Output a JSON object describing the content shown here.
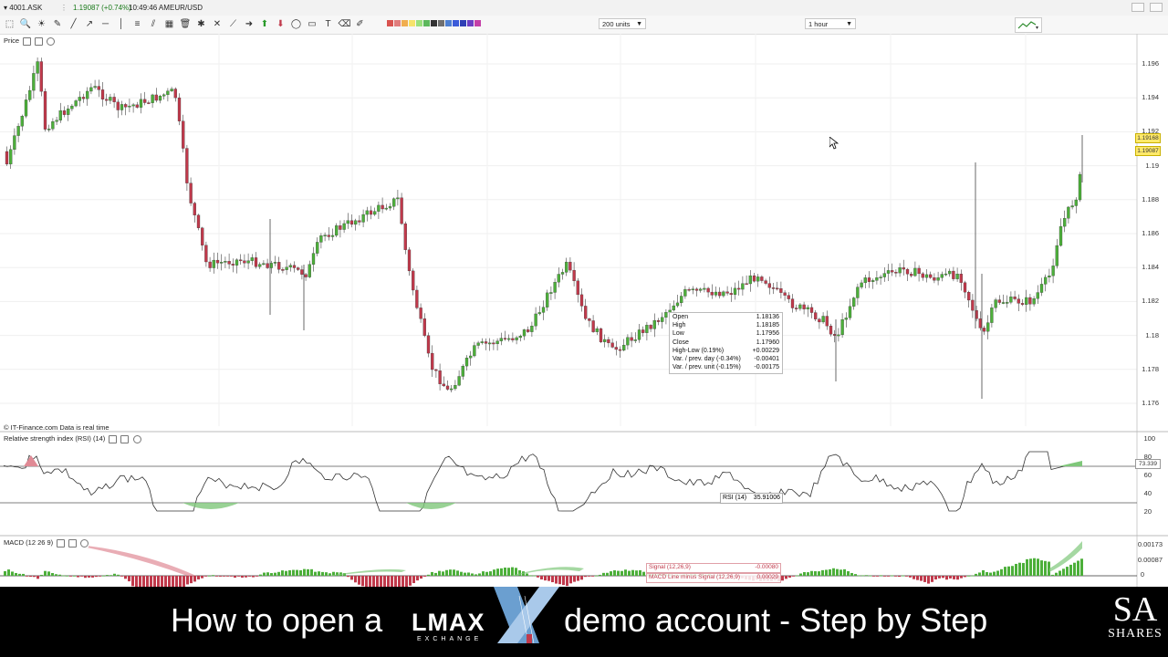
{
  "titlebar": {
    "instrument": "4001.ASK",
    "price_change": "1.19087 (+0.74%)",
    "time": "10:49:46 AM",
    "symbol": "EUR/USD"
  },
  "toolbar": {
    "units_select": "200 units",
    "interval_select": "1 hour",
    "icons": [
      "pointer-icon",
      "zoom-icon",
      "sun-icon",
      "pencil-icon",
      "line-icon",
      "ray-icon",
      "hline-icon",
      "vline-icon",
      "fibonacci-icon",
      "channel-icon",
      "grid-icon",
      "trash-icon",
      "tools-icon",
      "cross-icon",
      "fan-icon",
      "arrow-right-icon",
      "arrow-up-icon",
      "arrow-down-icon",
      "shape-icon",
      "rectangle-icon",
      "text-icon",
      "eraser-icon",
      "marker-icon"
    ],
    "swatches": [
      "#d9534f",
      "#e07d7d",
      "#f0ad4e",
      "#f6e36b",
      "#9be07d",
      "#5cb85c",
      "#333333",
      "#6f6f6f",
      "#4d7fd1",
      "#3b5bd9",
      "#2f3fb5",
      "#6c3fc4",
      "#c43fa8"
    ]
  },
  "price_panel": {
    "label": "Price",
    "credit": "© IT-Finance.com  Data is real time",
    "y_ticks": [
      "1.196",
      "1.194",
      "1.192",
      "1.19",
      "1.188",
      "1.186",
      "1.184",
      "1.182",
      "1.18",
      "1.178",
      "1.176"
    ],
    "price_tags": [
      "1.19168",
      "1.19087"
    ]
  },
  "tooltip": {
    "rows": [
      {
        "k": "Open",
        "v": "1.18136"
      },
      {
        "k": "High",
        "v": "1.18185"
      },
      {
        "k": "Low",
        "v": "1.17956"
      },
      {
        "k": "Close",
        "v": "1.17960"
      },
      {
        "k": "High-Low (0.19%)",
        "v": "+0.00229"
      },
      {
        "k": "Var. / prev. day (-0.34%)",
        "v": "-0.00401"
      },
      {
        "k": "Var. / prev. unit (-0.15%)",
        "v": "-0.00175"
      }
    ]
  },
  "rsi_panel": {
    "label": "Relative strength index (RSI) (14)",
    "y_ticks": [
      "100",
      "80",
      "60",
      "40",
      "20"
    ],
    "current_value": "73.339",
    "readout_name": "RSI (14)",
    "readout_value": "35.91006"
  },
  "macd_panel": {
    "label": "MACD (12 26 9)",
    "y_ticks": [
      "0.00173",
      "0.00087",
      "0"
    ],
    "signal_label": "Signal (12,26,9)",
    "signal_value": "-0.00080",
    "hist_label": "MACD Line minus Signal (12,26,9)",
    "hist_value": "0.00029"
  },
  "caption": {
    "left_text": "How to open a",
    "logo_text": "LMAX",
    "logo_sub": "EXCHANGE",
    "right_text": "demo account - Step by Step",
    "brand_top": "SA",
    "brand_bottom": "SHARES"
  },
  "colors": {
    "bull": "#4caf3a",
    "bear": "#c0394b",
    "grid": "#eeeeee",
    "rsi_fill_top": "#4caf3a",
    "macd_pos": "#4caf3a",
    "macd_neg": "#c0394b",
    "price_tag": "#ffe96a"
  }
}
